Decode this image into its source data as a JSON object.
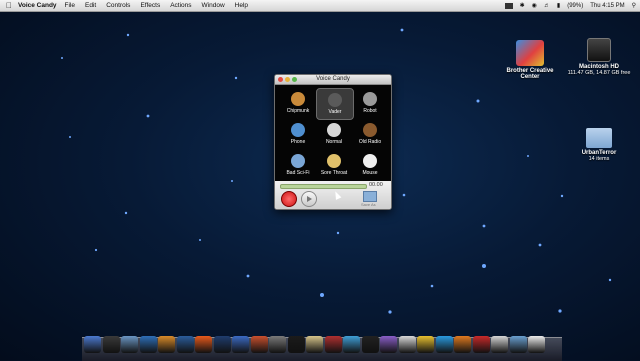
{
  "menubar": {
    "app_name": "Voice Candy",
    "items": [
      "File",
      "Edit",
      "Controls",
      "Effects",
      "Actions",
      "Window",
      "Help"
    ],
    "battery": "(99%)",
    "clock": "Thu 4:15 PM"
  },
  "desktop": {
    "brother": {
      "line1": "Brother Creative",
      "line2": "Center"
    },
    "macintosh_hd": {
      "name": "Macintosh HD",
      "info": "111.47 GB, 14.87 GB free"
    },
    "urbanterror": {
      "name": "UrbanTerror",
      "info": "14 items"
    }
  },
  "window": {
    "title": "Voice Candy",
    "effects": [
      {
        "label": "Chipmunk",
        "color": "#c98a3a"
      },
      {
        "label": "Vader",
        "color": "#5a5a5a"
      },
      {
        "label": "Robot",
        "color": "#9a9a9a"
      },
      {
        "label": "Phone",
        "color": "#4f8fd0"
      },
      {
        "label": "Normal",
        "color": "#d8d8d8"
      },
      {
        "label": "Old Radio",
        "color": "#8a5a2e"
      },
      {
        "label": "Bad Sci-Fi",
        "color": "#7aa6d6"
      },
      {
        "label": "Sore Throat",
        "color": "#e0c06a"
      },
      {
        "label": "Mouse",
        "color": "#efefef"
      }
    ],
    "selected": "Vader",
    "time": "00.00",
    "save_label": "Save As"
  },
  "dock_colors": [
    "#4c7ad0",
    "#3a3a3a",
    "#6b96c4",
    "#2e6fb8",
    "#d98b2a",
    "#2b5d9c",
    "#e85a1c",
    "#1f3d6f",
    "#3b6bc4",
    "#c9502e",
    "#7a7a7a",
    "#1b1b1b",
    "#d6c48a",
    "#b03030",
    "#3fa0d8",
    "#222",
    "#8a5fc8",
    "#d8d8d8",
    "#e8c030",
    "#2a9ae0",
    "#e07a20",
    "#c82a2a",
    "#d5d5d5",
    "#6aa0d0",
    "#ececec"
  ]
}
